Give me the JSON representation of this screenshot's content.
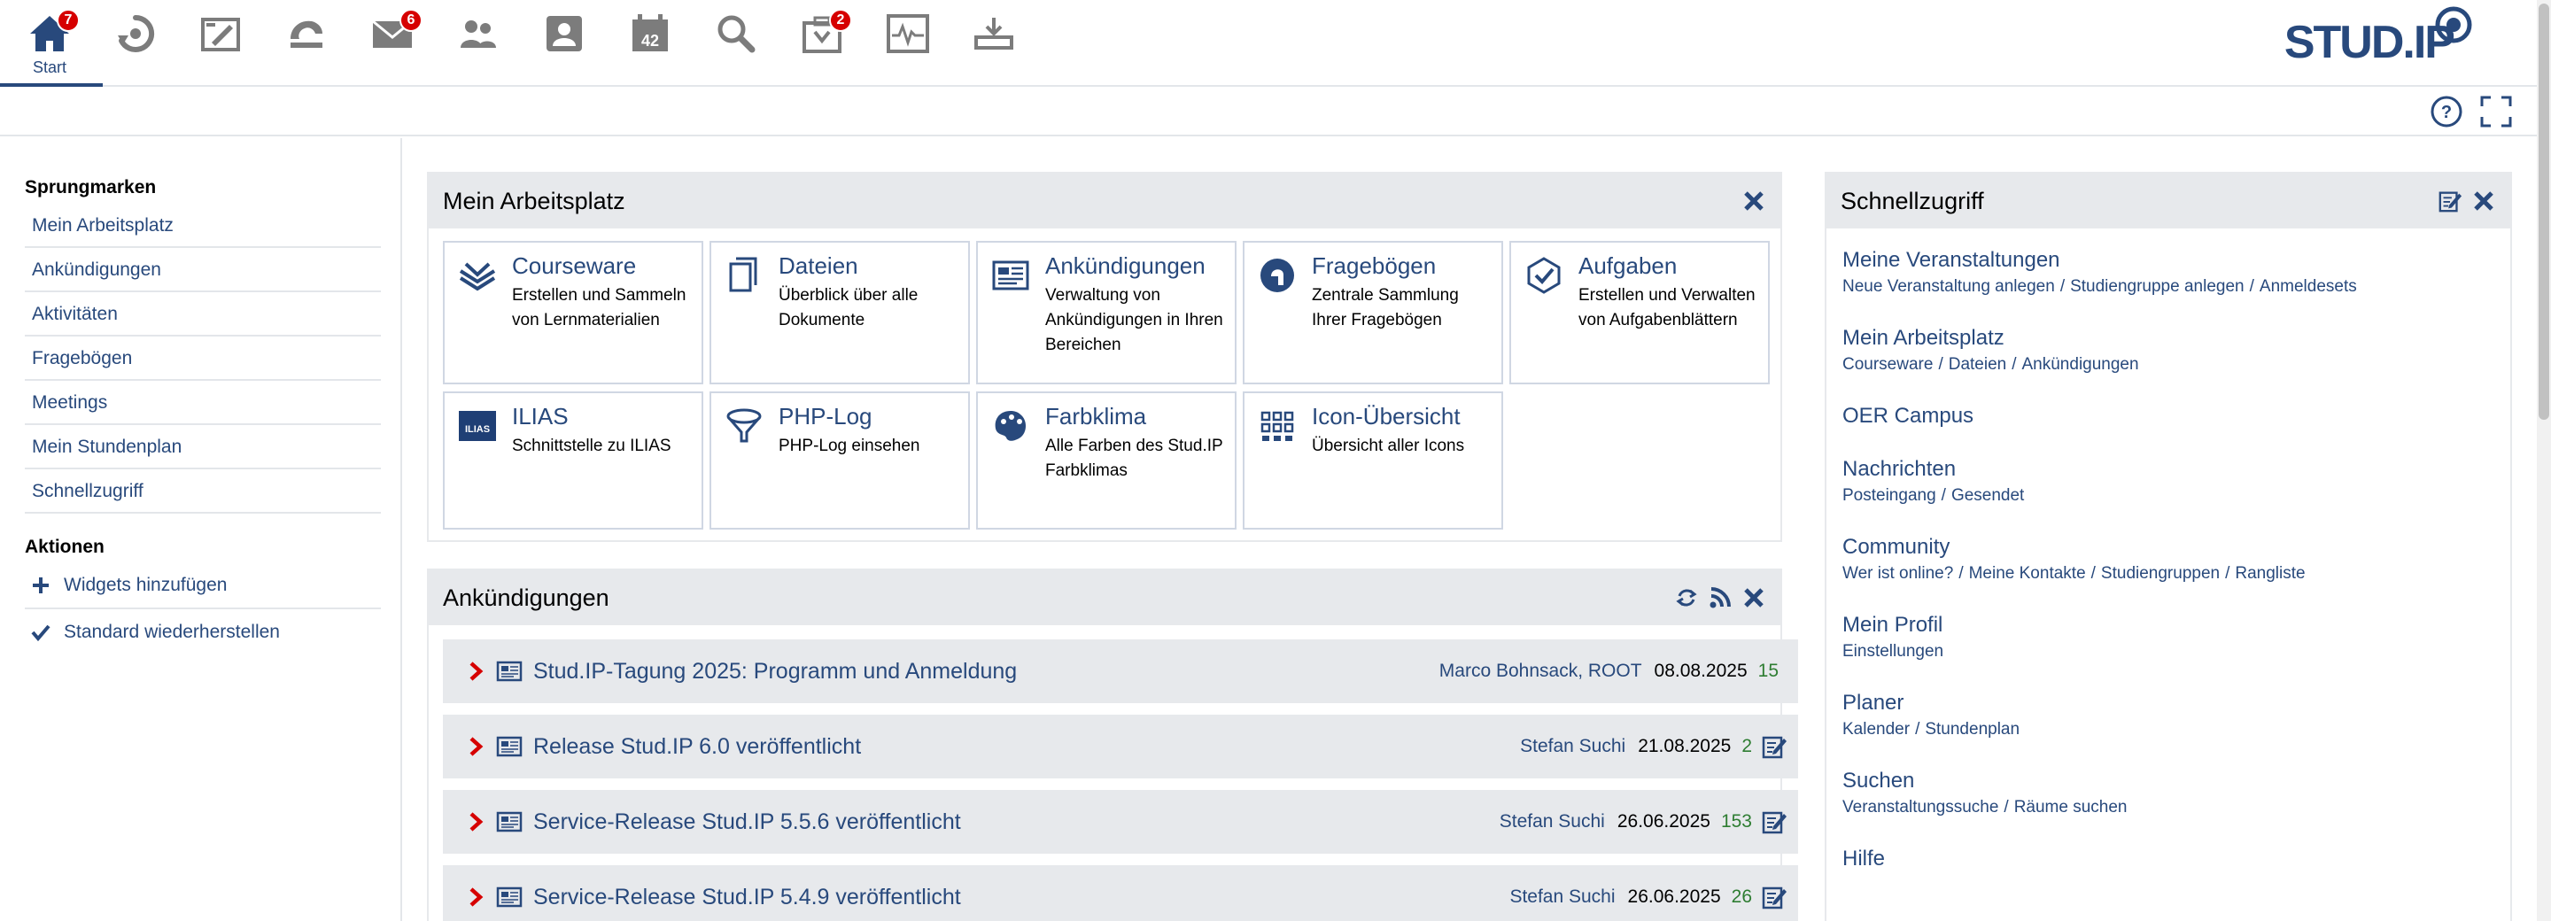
{
  "nav": {
    "start_label": "Start",
    "start_badge": "7",
    "messages_badge": "6",
    "ilias_badge": "2",
    "calendar_day": "42"
  },
  "logo": {
    "text": "STUD.IP"
  },
  "sidebar": {
    "jump_heading": "Sprungmarken",
    "jump_items": [
      "Mein Arbeitsplatz",
      "Ankündigungen",
      "Aktivitäten",
      "Fragebögen",
      "Meetings",
      "Mein Stundenplan",
      "Schnellzugriff"
    ],
    "actions_heading": "Aktionen",
    "actions": [
      "Widgets hinzufügen",
      "Standard wiederherstellen"
    ]
  },
  "workplace": {
    "title": "Mein Arbeitsplatz",
    "tiles": [
      {
        "name": "Courseware",
        "desc": "Erstellen und Sammeln von Lernmaterialien",
        "icon": "courseware-icon"
      },
      {
        "name": "Dateien",
        "desc": "Überblick über alle Dokumente",
        "icon": "files-icon"
      },
      {
        "name": "Ankündigungen",
        "desc": "Verwaltung von Ankündigungen in Ihren Bereichen",
        "icon": "news-icon"
      },
      {
        "name": "Fragebögen",
        "desc": "Zentrale Sammlung Ihrer Fragebögen",
        "icon": "vote-icon"
      },
      {
        "name": "Aufgaben",
        "desc": "Erstellen und Verwalten von Aufgabenblättern",
        "icon": "task-icon"
      },
      {
        "name": "ILIAS",
        "desc": "Schnittstelle zu ILIAS",
        "icon": "ilias-icon"
      },
      {
        "name": "PHP-Log",
        "desc": "PHP-Log einsehen",
        "icon": "log-icon"
      },
      {
        "name": "Farbklima",
        "desc": "Alle Farben des Stud.IP Farbklimas",
        "icon": "palette-icon"
      },
      {
        "name": "Icon-Übersicht",
        "desc": "Übersicht aller Icons",
        "icon": "icon-grid-icon"
      }
    ]
  },
  "announcements": {
    "title": "Ankündigungen",
    "items": [
      {
        "title": "Stud.IP-Tagung 2025: Programm und Anmeldung",
        "author": "Marco Bohnsack, ROOT",
        "date": "08.08.2025",
        "views": "15"
      },
      {
        "title": "Release Stud.IP 6.0 veröffentlicht",
        "author": "Stefan Suchi",
        "date": "21.08.2025",
        "views": "2"
      },
      {
        "title": "Service-Release Stud.IP 5.5.6 veröffentlicht",
        "author": "Stefan Suchi",
        "date": "26.06.2025",
        "views": "153"
      },
      {
        "title": "Service-Release Stud.IP 5.4.9 veröffentlicht",
        "author": "Stefan Suchi",
        "date": "26.06.2025",
        "views": "26"
      }
    ]
  },
  "quickaccess": {
    "title": "Schnellzugriff",
    "items": [
      {
        "title": "Meine Veranstaltungen",
        "subs": [
          "Neue Veranstaltung anlegen",
          "Studiengruppe anlegen",
          "Anmeldesets"
        ]
      },
      {
        "title": "Mein Arbeitsplatz",
        "subs": [
          "Courseware",
          "Dateien",
          "Ankündigungen"
        ]
      },
      {
        "title": "OER Campus",
        "subs": []
      },
      {
        "title": "Nachrichten",
        "subs": [
          "Posteingang",
          "Gesendet"
        ]
      },
      {
        "title": "Community",
        "subs": [
          "Wer ist online?",
          "Meine Kontakte",
          "Studiengruppen",
          "Rangliste"
        ]
      },
      {
        "title": "Mein Profil",
        "subs": [
          "Einstellungen"
        ]
      },
      {
        "title": "Planer",
        "subs": [
          "Kalender",
          "Stundenplan"
        ]
      },
      {
        "title": "Suchen",
        "subs": [
          "Veranstaltungssuche",
          "Räume suchen"
        ]
      },
      {
        "title": "Hilfe",
        "subs": []
      }
    ]
  },
  "colors": {
    "primary": "#28497c",
    "badge": "#d60000",
    "widget_header": "#e7e9ec",
    "views": "#2e7d32"
  }
}
